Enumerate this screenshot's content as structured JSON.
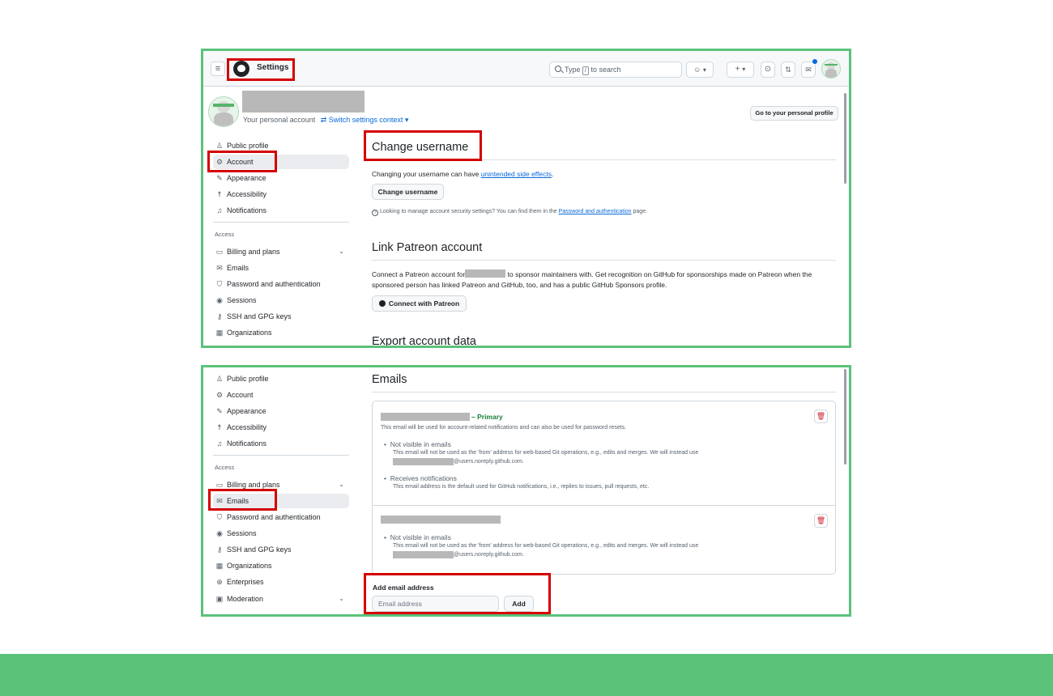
{
  "screenshot_top": {
    "header": {
      "menu_icon": "≡",
      "title": "Settings",
      "search_prefix": "Type",
      "search_key": "/",
      "search_suffix": "to search",
      "plus_label": "+"
    },
    "account": {
      "context_label": "Your personal account",
      "switch_link": "Switch settings context ▾",
      "profile_button": "Go to your personal profile"
    },
    "sidebar": {
      "items": [
        {
          "label": "Public profile",
          "icon": "person-icon"
        },
        {
          "label": "Account",
          "icon": "gear-icon"
        },
        {
          "label": "Appearance",
          "icon": "paintbrush-icon"
        },
        {
          "label": "Accessibility",
          "icon": "accessibility-icon"
        },
        {
          "label": "Notifications",
          "icon": "bell-icon"
        }
      ],
      "section_heading": "Access",
      "access_items": [
        {
          "label": "Billing and plans",
          "icon": "credit-card-icon"
        },
        {
          "label": "Emails",
          "icon": "mail-icon"
        },
        {
          "label": "Password and authentication",
          "icon": "shield-icon"
        },
        {
          "label": "Sessions",
          "icon": "broadcast-icon"
        },
        {
          "label": "SSH and GPG keys",
          "icon": "key-icon"
        },
        {
          "label": "Organizations",
          "icon": "organization-icon"
        }
      ]
    },
    "main": {
      "change_username_title": "Change username",
      "change_username_text": "Changing your username can have",
      "side_effects_link": "unintended side effects",
      "change_username_button": "Change username",
      "security_note_text": "Looking to manage account security settings? You can find them in the",
      "security_note_link": "Password and authentication",
      "security_note_end": "page.",
      "patreon_title": "Link Patreon account",
      "patreon_text_a": "Connect a Patreon account for",
      "patreon_text_b": "to sponsor maintainers with. Get recognition on GitHub for sponsorships made on Patreon when the",
      "patreon_text_c": "sponsored person has linked Patreon and GitHub, too, and has a public GitHub Sponsors profile.",
      "patreon_button": "Connect with Patreon",
      "export_title": "Export account data"
    }
  },
  "screenshot_bottom": {
    "sidebar": {
      "items": [
        {
          "label": "Public profile",
          "icon": "person-icon"
        },
        {
          "label": "Account",
          "icon": "gear-icon"
        },
        {
          "label": "Appearance",
          "icon": "paintbrush-icon"
        },
        {
          "label": "Accessibility",
          "icon": "accessibility-icon"
        },
        {
          "label": "Notifications",
          "icon": "bell-icon"
        }
      ],
      "section_heading": "Access",
      "access_items": [
        {
          "label": "Billing and plans",
          "icon": "credit-card-icon"
        },
        {
          "label": "Emails",
          "icon": "mail-icon"
        },
        {
          "label": "Password and authentication",
          "icon": "shield-icon"
        },
        {
          "label": "Sessions",
          "icon": "broadcast-icon"
        },
        {
          "label": "SSH and GPG keys",
          "icon": "key-icon"
        },
        {
          "label": "Organizations",
          "icon": "organization-icon"
        },
        {
          "label": "Enterprises",
          "icon": "globe-icon"
        },
        {
          "label": "Moderation",
          "icon": "report-icon"
        }
      ]
    },
    "emails": {
      "title": "Emails",
      "primary_badge": "Primary",
      "primary_note": "This email will be used for account-related notifications and can also be used for password resets.",
      "not_visible_title": "Not visible in emails",
      "not_visible_text": "This email will not be used as the 'from' address for web-based Git operations, e.g., edits and merges. We will instead use",
      "noreply_suffix": "@users.noreply.github.com.",
      "receives_title": "Receives notifications",
      "receives_text": "This email address is the default used for GitHub notifications, i.e., replies to issues, pull requests, etc.",
      "add_label": "Add email address",
      "input_placeholder": "Email address",
      "add_button": "Add"
    }
  },
  "colors": {
    "frame_green": "#5bc27a",
    "highlight_red": "#d40000",
    "link_blue": "#0969da",
    "primary_green": "#1a7f37",
    "delete_red": "#cf222e"
  }
}
